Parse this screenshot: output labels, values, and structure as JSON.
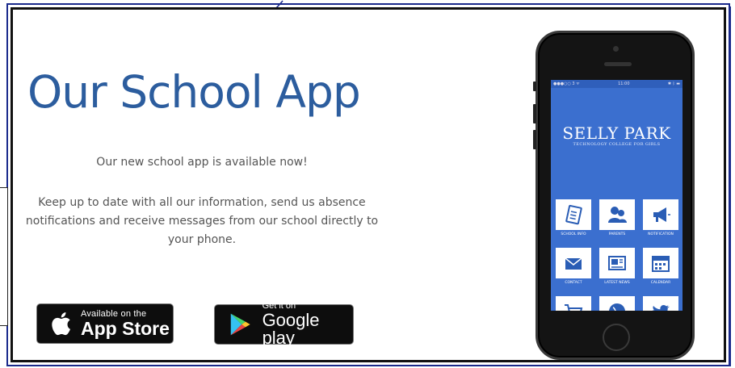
{
  "hero": {
    "title": "Our School App",
    "subtitle": "Our new school app is available now!",
    "description": "Keep up to date with all our information, send us absence notifications and receive messages from our school directly to your phone."
  },
  "badges": {
    "apple": {
      "small": "Available on the",
      "big": "App Store"
    },
    "google": {
      "small": "Get it on",
      "big": "Google play"
    }
  },
  "phone": {
    "status_left": "●●●○○ 3 ᯤ",
    "status_time": "11:00",
    "status_right": "✱ ᛒ ▬",
    "school_name": "SELLY PARK",
    "school_subtitle": "TECHNOLOGY COLLEGE FOR GIRLS",
    "tiles": [
      {
        "label": "SCHOOL INFO",
        "icon": "notebook-icon"
      },
      {
        "label": "PARENTS",
        "icon": "people-icon"
      },
      {
        "label": "NOTIFICATION",
        "icon": "megaphone-icon"
      },
      {
        "label": "CONTACT",
        "icon": "envelope-icon"
      },
      {
        "label": "LATEST NEWS",
        "icon": "newspaper-icon"
      },
      {
        "label": "CALENDAR",
        "icon": "calendar-icon"
      },
      {
        "label": "",
        "icon": "cart-icon"
      },
      {
        "label": "",
        "icon": "globe-icon"
      },
      {
        "label": "",
        "icon": "twitter-icon"
      }
    ]
  },
  "colors": {
    "title": "#2c5d9e",
    "screen": "#3b6fcf",
    "icon_blue": "#2a5db5",
    "frame": "#1a2a8c"
  }
}
